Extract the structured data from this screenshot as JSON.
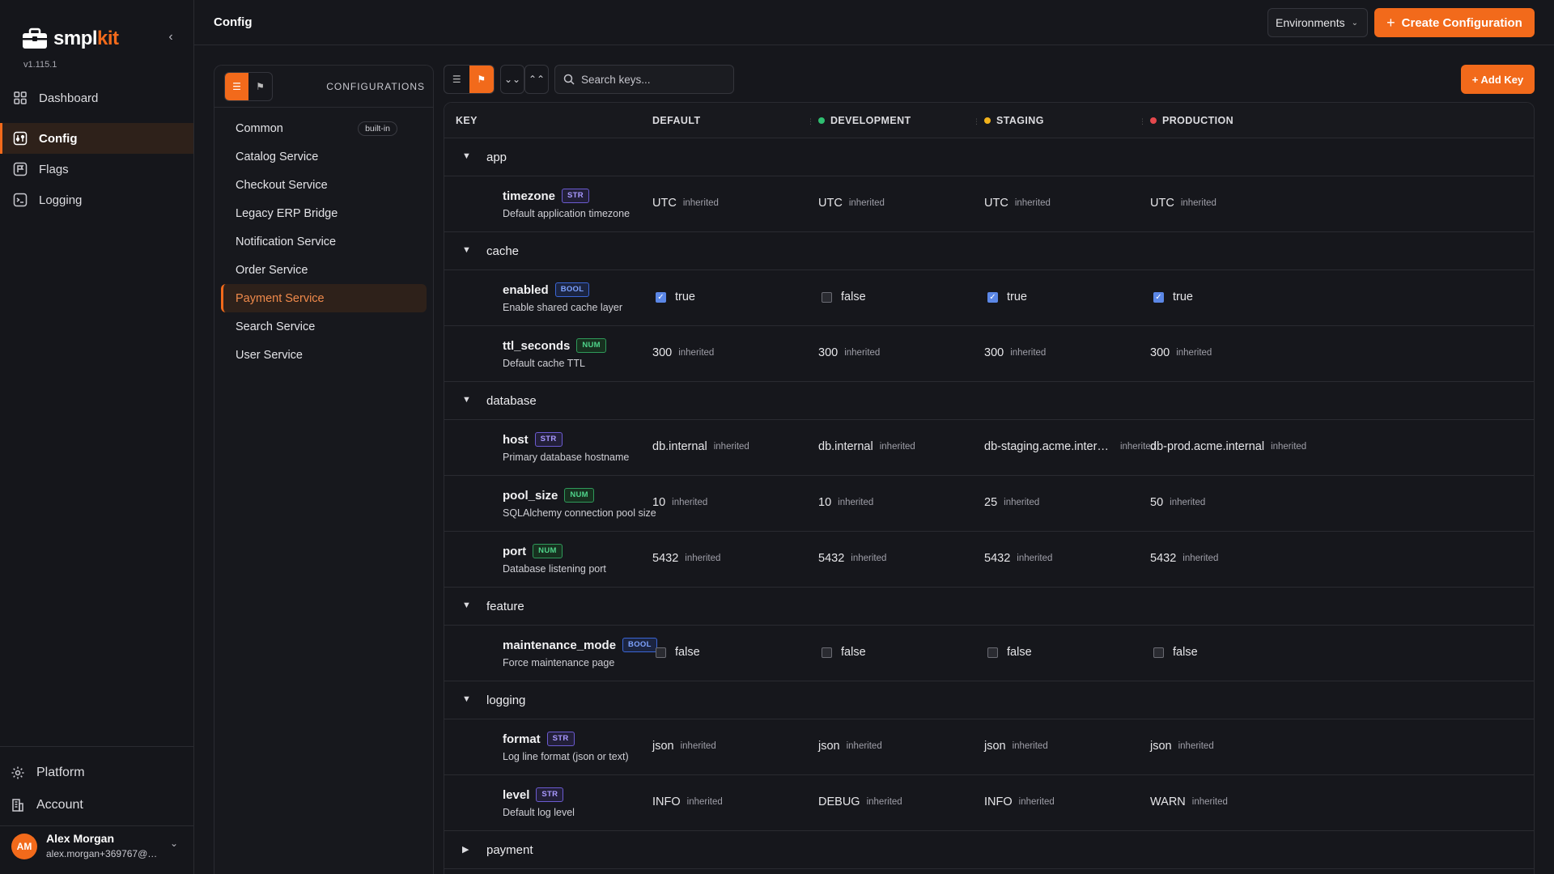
{
  "brand": {
    "name_a": "smpl",
    "name_b": "kit",
    "version": "v1.115.1"
  },
  "sidebar": {
    "nav": [
      {
        "label": "Dashboard",
        "icon": "grid-icon",
        "active": false
      },
      {
        "label": "Config",
        "icon": "sliders-icon",
        "active": true
      },
      {
        "label": "Flags",
        "icon": "flag-icon",
        "active": false
      },
      {
        "label": "Logging",
        "icon": "terminal-icon",
        "active": false
      }
    ],
    "bottom": [
      {
        "label": "Platform",
        "icon": "gear-icon"
      },
      {
        "label": "Account",
        "icon": "building-icon"
      }
    ],
    "user": {
      "initials": "AM",
      "name": "Alex Morgan",
      "email": "alex.morgan+369767@…"
    }
  },
  "header": {
    "title": "Config",
    "environments_label": "Environments",
    "create_label": "Create Configuration"
  },
  "configs": {
    "title": "CONFIGURATIONS",
    "builtin_label": "built-in",
    "items": [
      {
        "label": "Common",
        "builtin": true,
        "active": false
      },
      {
        "label": "Catalog Service",
        "active": false
      },
      {
        "label": "Checkout Service",
        "active": false
      },
      {
        "label": "Legacy ERP Bridge",
        "active": false
      },
      {
        "label": "Notification Service",
        "active": false
      },
      {
        "label": "Order Service",
        "active": false
      },
      {
        "label": "Payment Service",
        "active": true
      },
      {
        "label": "Search Service",
        "active": false
      },
      {
        "label": "User Service",
        "active": false
      }
    ]
  },
  "toolbar": {
    "search_placeholder": "Search keys...",
    "add_key_label": "+ Add Key"
  },
  "table": {
    "columns": [
      {
        "label": "KEY",
        "dot": null
      },
      {
        "label": "DEFAULT",
        "dot": null
      },
      {
        "label": "DEVELOPMENT",
        "dot": "#2fbf71"
      },
      {
        "label": "STAGING",
        "dot": "#f2b21b"
      },
      {
        "label": "PRODUCTION",
        "dot": "#e5484d"
      }
    ],
    "inherited_label": "inherited",
    "groups": [
      {
        "name": "app",
        "expanded": true,
        "keys": [
          {
            "name": "timezone",
            "type": "STR",
            "desc": "Default application timezone",
            "values": [
              {
                "v": "UTC",
                "inh": true
              },
              {
                "v": "UTC",
                "inh": true
              },
              {
                "v": "UTC",
                "inh": true
              },
              {
                "v": "UTC",
                "inh": true
              }
            ]
          }
        ]
      },
      {
        "name": "cache",
        "expanded": true,
        "keys": [
          {
            "name": "enabled",
            "type": "BOOL",
            "desc": "Enable shared cache layer",
            "values": [
              {
                "v": "true",
                "bool": true,
                "checked": true
              },
              {
                "v": "false",
                "bool": true,
                "checked": false
              },
              {
                "v": "true",
                "bool": true,
                "checked": true
              },
              {
                "v": "true",
                "bool": true,
                "checked": true
              }
            ]
          },
          {
            "name": "ttl_seconds",
            "type": "NUM",
            "desc": "Default cache TTL",
            "values": [
              {
                "v": "300",
                "inh": true
              },
              {
                "v": "300",
                "inh": true
              },
              {
                "v": "300",
                "inh": true
              },
              {
                "v": "300",
                "inh": true
              }
            ]
          }
        ]
      },
      {
        "name": "database",
        "expanded": true,
        "keys": [
          {
            "name": "host",
            "type": "STR",
            "desc": "Primary database hostname",
            "values": [
              {
                "v": "db.internal",
                "inh": true
              },
              {
                "v": "db.internal",
                "inh": true
              },
              {
                "v": "db-staging.acme.inter…",
                "inh": true
              },
              {
                "v": "db-prod.acme.internal",
                "inh": true
              }
            ]
          },
          {
            "name": "pool_size",
            "type": "NUM",
            "desc": "SQLAlchemy connection pool size",
            "values": [
              {
                "v": "10",
                "inh": true
              },
              {
                "v": "10",
                "inh": true
              },
              {
                "v": "25",
                "inh": true
              },
              {
                "v": "50",
                "inh": true
              }
            ]
          },
          {
            "name": "port",
            "type": "NUM",
            "desc": "Database listening port",
            "values": [
              {
                "v": "5432",
                "inh": true
              },
              {
                "v": "5432",
                "inh": true
              },
              {
                "v": "5432",
                "inh": true
              },
              {
                "v": "5432",
                "inh": true
              }
            ]
          }
        ]
      },
      {
        "name": "feature",
        "expanded": true,
        "keys": [
          {
            "name": "maintenance_mode",
            "type": "BOOL",
            "desc": "Force maintenance page",
            "values": [
              {
                "v": "false",
                "bool": true,
                "checked": false
              },
              {
                "v": "false",
                "bool": true,
                "checked": false
              },
              {
                "v": "false",
                "bool": true,
                "checked": false
              },
              {
                "v": "false",
                "bool": true,
                "checked": false
              }
            ]
          }
        ]
      },
      {
        "name": "logging",
        "expanded": true,
        "keys": [
          {
            "name": "format",
            "type": "STR",
            "desc": "Log line format (json or text)",
            "values": [
              {
                "v": "json",
                "inh": true
              },
              {
                "v": "json",
                "inh": true
              },
              {
                "v": "json",
                "inh": true
              },
              {
                "v": "json",
                "inh": true
              }
            ]
          },
          {
            "name": "level",
            "type": "STR",
            "desc": "Default log level",
            "values": [
              {
                "v": "INFO",
                "inh": true
              },
              {
                "v": "DEBUG",
                "inh": true
              },
              {
                "v": "INFO",
                "inh": true
              },
              {
                "v": "WARN",
                "inh": true
              }
            ]
          }
        ]
      },
      {
        "name": "payment",
        "expanded": false,
        "keys": []
      }
    ]
  }
}
